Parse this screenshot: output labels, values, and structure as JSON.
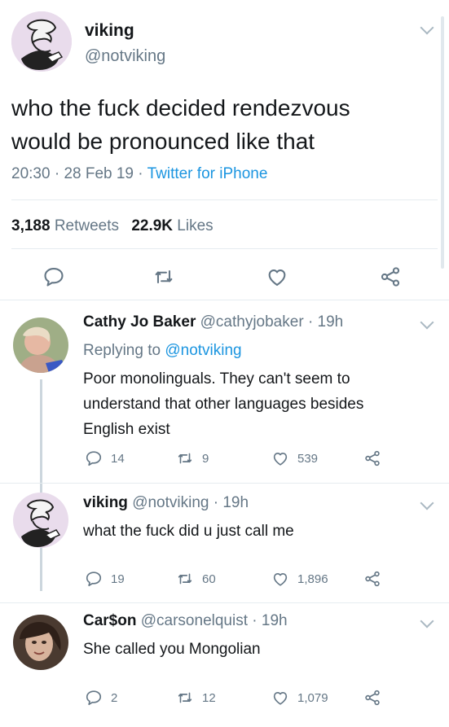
{
  "main_tweet": {
    "display_name": "viking",
    "handle": "@notviking",
    "text_line1": "who the fuck decided rendezvous",
    "text_line2": "would be pronounced like that",
    "time": "20:30",
    "date": "28 Feb 19",
    "source": "Twitter for iPhone",
    "retweets_count": "3,188",
    "retweets_label": "Retweets",
    "likes_count": "22.9K",
    "likes_label": "Likes"
  },
  "replies": [
    {
      "display_name": "Cathy Jo Baker",
      "handle": "@cathyjobaker",
      "age": "19h",
      "replying_prefix": "Replying to",
      "replying_handle": "@notviking",
      "text_line1": "Poor monolinguals. They can't seem to",
      "text_line2": "understand that other languages besides",
      "text_line3": "English exist",
      "replies": "14",
      "retweets": "9",
      "likes": "539"
    },
    {
      "display_name": "viking",
      "handle": "@notviking",
      "age": "19h",
      "text_line1": "what the fuck did u just call me",
      "replies": "19",
      "retweets": "60",
      "likes": "1,896"
    },
    {
      "display_name": "Car$on",
      "handle": "@carsonelquist",
      "age": "19h",
      "text_line1": "She called you Mongolian",
      "replies": "2",
      "retweets": "12",
      "likes": "1,079"
    }
  ],
  "separator": "·",
  "icons": [
    "reply-icon",
    "retweet-icon",
    "like-icon",
    "share-icon",
    "chevron-down-icon"
  ],
  "colors": {
    "link": "#1b95e0",
    "secondary": "#657786",
    "divider": "#e6ecf0"
  }
}
